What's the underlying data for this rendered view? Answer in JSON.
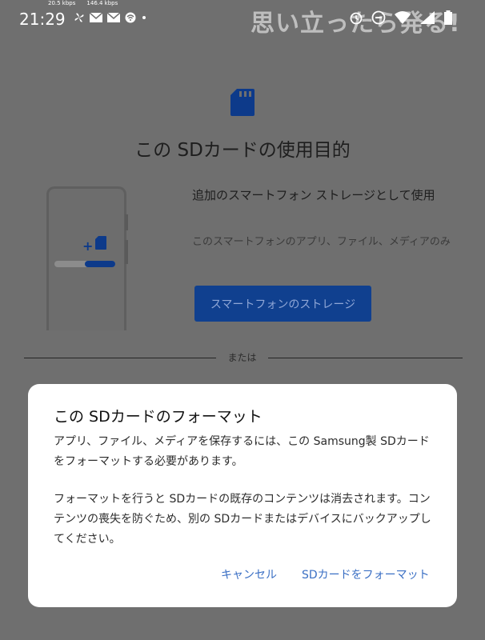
{
  "status_bar": {
    "time": "21:29",
    "net_up": "20.5 kbps",
    "net_down": "146.4 kbps"
  },
  "watermark": "思い立ったら発る!",
  "page": {
    "title": "この SDカードの使用目的",
    "option_title": "追加のスマートフォン ストレージとして使用",
    "option_subtitle": "このスマートフォンのアプリ、ファイル、メディアのみ",
    "option_button": "スマートフォンのストレージ",
    "divider_text": "または"
  },
  "dialog": {
    "title": "この SDカードのフォーマット",
    "paragraph1": "アプリ、ファイル、メディアを保存するには、この Samsung製 SDカードをフォーマットする必要があります。",
    "paragraph2": "フォーマットを行うと SDカードの既存のコンテンツは消去されます。コンテンツの喪失を防ぐため、別の SDカードまたはデバイスにバックアップしてください。",
    "cancel_label": "キャンセル",
    "format_label": "SDカードをフォーマット"
  },
  "colors": {
    "accent": "#3a6fc4",
    "scrim_bg": "#6f6f6f",
    "option_button_bg": "#10408f"
  }
}
